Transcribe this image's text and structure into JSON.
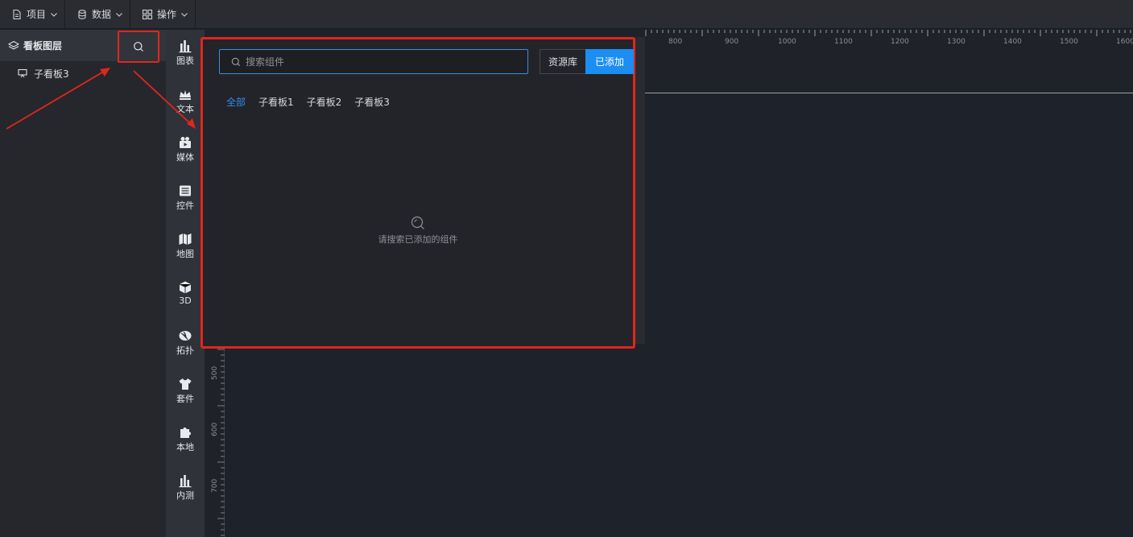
{
  "toolbar": {
    "menus": [
      {
        "label": "项目",
        "icon": "file-icon"
      },
      {
        "label": "数据",
        "icon": "database-icon"
      },
      {
        "label": "操作",
        "icon": "grid-icon"
      }
    ]
  },
  "layers": {
    "title": "看板图层",
    "items": [
      {
        "label": "子看板3",
        "icon": "monitor-icon"
      }
    ]
  },
  "categories": [
    {
      "label": "图表",
      "icon": "bar-chart-icon"
    },
    {
      "label": "文本",
      "icon": "crown-text-icon"
    },
    {
      "label": "媒体",
      "icon": "camera-icon"
    },
    {
      "label": "控件",
      "icon": "list-icon"
    },
    {
      "label": "地图",
      "icon": "map-icon"
    },
    {
      "label": "3D",
      "icon": "cube-icon"
    },
    {
      "label": "拓扑",
      "icon": "topology-icon"
    },
    {
      "label": "套件",
      "icon": "shirt-icon"
    },
    {
      "label": "本地",
      "icon": "puzzle-icon"
    },
    {
      "label": "内测",
      "icon": "bar-chart-icon"
    }
  ],
  "popup": {
    "search_placeholder": "搜索组件",
    "search_value": "",
    "library_label": "资源库",
    "added_label": "已添加",
    "tabs": [
      {
        "label": "全部",
        "active": true
      },
      {
        "label": "子看板1",
        "active": false
      },
      {
        "label": "子看板2",
        "active": false
      },
      {
        "label": "子看板3",
        "active": false
      }
    ],
    "empty_text": "请搜索已添加的组件"
  },
  "ruler": {
    "top_labels": [
      "800",
      "900",
      "1000",
      "1100",
      "1200",
      "1300",
      "1400",
      "1500",
      "1600"
    ],
    "left_labels": [
      "500",
      "600",
      "700"
    ]
  },
  "colors": {
    "accent": "#1c8ef2",
    "highlight": "#e1261c",
    "background": "#1d222b"
  }
}
